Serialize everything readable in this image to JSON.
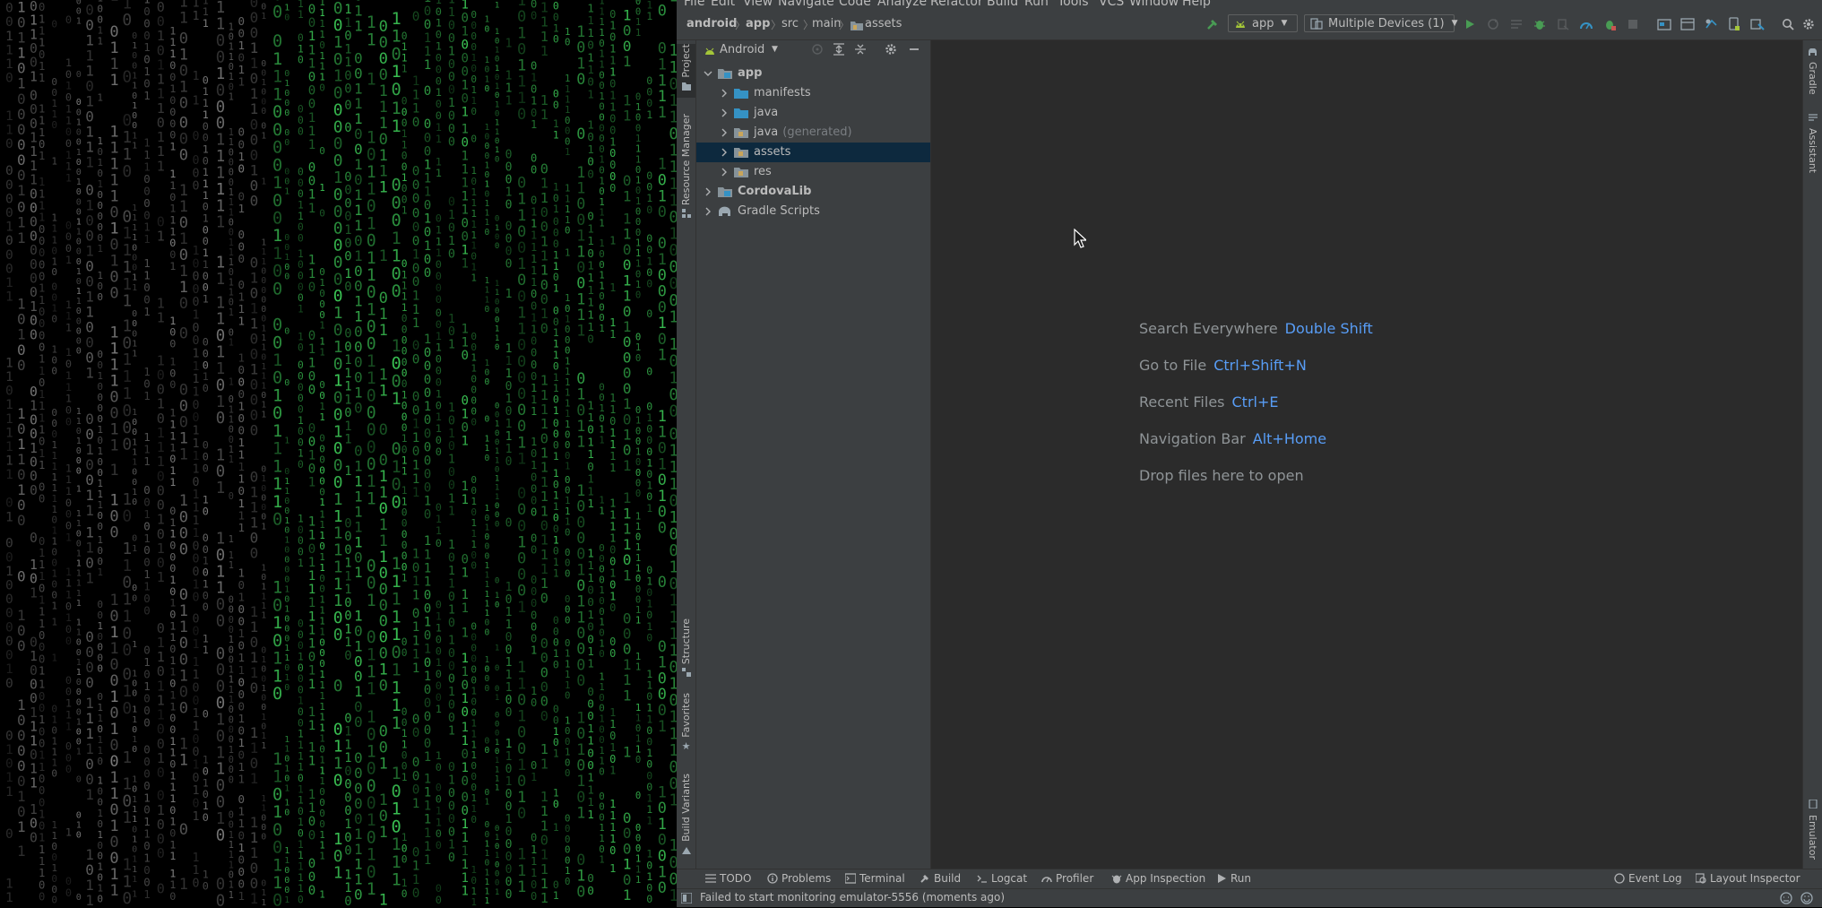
{
  "menu": {
    "items": [
      {
        "label": "File"
      },
      {
        "label": "Edit"
      },
      {
        "label": "View"
      },
      {
        "label": "Navigate"
      },
      {
        "label": "Code"
      },
      {
        "label": "Analyze"
      },
      {
        "label": "Refactor"
      },
      {
        "label": "Build"
      },
      {
        "label": "Run"
      },
      {
        "label": "Tools"
      },
      {
        "label": "VCS"
      },
      {
        "label": "Window"
      },
      {
        "label": "Help"
      }
    ]
  },
  "breadcrumb": {
    "items": [
      "android",
      "app",
      "src",
      "main",
      "assets"
    ]
  },
  "toolbar": {
    "run_config": "app",
    "device_selector": "Multiple Devices (1)"
  },
  "left_strip": {
    "project": "Project",
    "resource_manager": "Resource Manager",
    "structure": "Structure",
    "favorites": "Favorites",
    "build_variants": "Build Variants"
  },
  "right_strip": {
    "gradle": "Gradle",
    "assistant": "Assistant",
    "emulator": "Emulator"
  },
  "project_panel": {
    "view_mode": "Android",
    "tree": [
      {
        "label": "app",
        "suffix": "",
        "bold": true,
        "level": 0,
        "expanded": true,
        "selected": false
      },
      {
        "label": "manifests",
        "suffix": "",
        "bold": false,
        "level": 1,
        "expanded": false,
        "selected": false
      },
      {
        "label": "java",
        "suffix": "",
        "bold": false,
        "level": 1,
        "expanded": false,
        "selected": false
      },
      {
        "label": "java",
        "suffix": "(generated)",
        "bold": false,
        "level": 1,
        "expanded": false,
        "selected": false
      },
      {
        "label": "assets",
        "suffix": "",
        "bold": false,
        "level": 1,
        "expanded": false,
        "selected": true
      },
      {
        "label": "res",
        "suffix": "",
        "bold": false,
        "level": 1,
        "expanded": false,
        "selected": false
      },
      {
        "label": "CordovaLib",
        "suffix": "",
        "bold": true,
        "level": 0,
        "expanded": false,
        "selected": false
      },
      {
        "label": "Gradle Scripts",
        "suffix": "",
        "bold": false,
        "level": 0,
        "expanded": false,
        "selected": false
      }
    ]
  },
  "editor": {
    "hints": [
      {
        "text": "Search Everywhere",
        "key": "Double Shift"
      },
      {
        "text": "Go to File",
        "key": "Ctrl+Shift+N"
      },
      {
        "text": "Recent Files",
        "key": "Ctrl+E"
      },
      {
        "text": "Navigation Bar",
        "key": "Alt+Home"
      },
      {
        "text": "Drop files here to open",
        "key": ""
      }
    ]
  },
  "bottom_tools": {
    "todo": "TODO",
    "problems": "Problems",
    "terminal": "Terminal",
    "build": "Build",
    "logcat": "Logcat",
    "profiler": "Profiler",
    "app_inspection": "App Inspection",
    "run": "Run",
    "event_log": "Event Log",
    "layout_inspector": "Layout Inspector"
  },
  "status": {
    "message": "Failed to start monitoring emulator-5556 (moments ago)"
  },
  "colors": {
    "matrix_green": "#3fd25a",
    "accent_blue": "#589df6",
    "selection": "#0d293e",
    "run_green": "#499c54",
    "android_green": "#a4c639"
  }
}
